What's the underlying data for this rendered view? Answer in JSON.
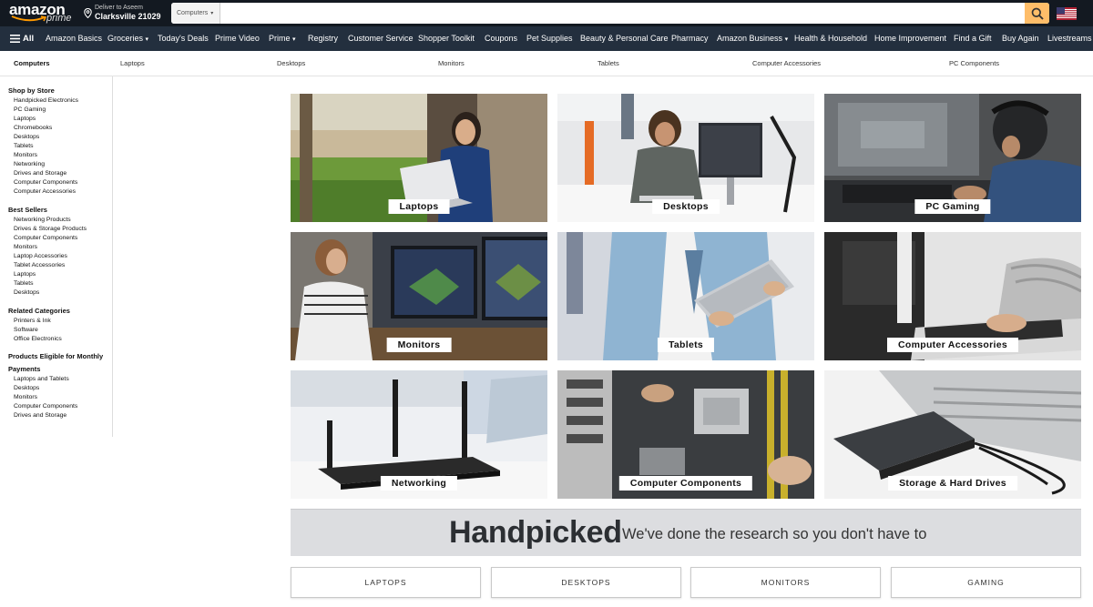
{
  "header": {
    "logo_text": "amazon",
    "logo_sub": "prime",
    "deliver_line1": "Deliver to Aseem",
    "deliver_line2": "Clarksville 21029",
    "search_category": "Computers",
    "search_placeholder": "",
    "icons": {
      "location": "location-pin-icon",
      "search": "search-icon",
      "flag": "us-flag-icon",
      "menu": "hamburger-menu-icon"
    },
    "colors": {
      "header_bg": "#131921",
      "nav_bg": "#232f3e",
      "search_button": "#febd69"
    }
  },
  "nav": {
    "all_label": "All",
    "items": [
      "Amazon Basics",
      "Groceries",
      "Today's Deals",
      "Prime Video",
      "Prime",
      "Registry",
      "Customer Service",
      "Shopper Toolkit",
      "Coupons",
      "Pet Supplies",
      "Beauty & Personal Care",
      "Pharmacy",
      "Amazon Business",
      "Health & Household",
      "Home Improvement",
      "Find a Gift",
      "Buy Again",
      "Livestreams"
    ],
    "groceries_caret": "▾",
    "prime_caret": "▾",
    "business_caret": "▾"
  },
  "subnav": {
    "items": [
      "Computers",
      "Laptops",
      "Desktops",
      "Monitors",
      "Tablets",
      "Computer Accessories",
      "PC Components"
    ]
  },
  "sidebar": {
    "shop_by_store": {
      "heading": "Shop by Store",
      "links": [
        "Handpicked Electronics",
        "PC Gaming",
        "Laptops",
        "Chromebooks",
        "Desktops",
        "Tablets",
        "Monitors",
        "Networking",
        "Drives and Storage",
        "Computer Components",
        "Computer Accessories"
      ]
    },
    "best_sellers": {
      "heading": "Best Sellers",
      "links": [
        "Networking Products",
        "Drives & Storage Products",
        "Computer Components",
        "Monitors",
        "Laptop Accessories",
        "Tablet Accessories",
        "Laptops",
        "Tablets",
        "Desktops"
      ]
    },
    "related": {
      "heading": "Related Categories",
      "links": [
        "Printers & Ink",
        "Software",
        "Office Electronics"
      ]
    },
    "monthly": {
      "heading_line1": "Products Eligible for Monthly",
      "heading_line2": "Payments",
      "links": [
        "Laptops and Tablets",
        "Desktops",
        "Monitors",
        "Computer Components",
        "Drives and Storage"
      ]
    }
  },
  "tiles": [
    "Laptops",
    "Desktops",
    "PC Gaming",
    "Monitors",
    "Tablets",
    "Computer Accessories",
    "Networking",
    "Computer Components",
    "Storage & Hard Drives"
  ],
  "banner": {
    "title": "Handpicked",
    "subtitle": "We've done the research so you don't have to"
  },
  "bottom_buttons": [
    "LAPTOPS",
    "DESKTOPS",
    "MONITORS",
    "GAMING"
  ]
}
